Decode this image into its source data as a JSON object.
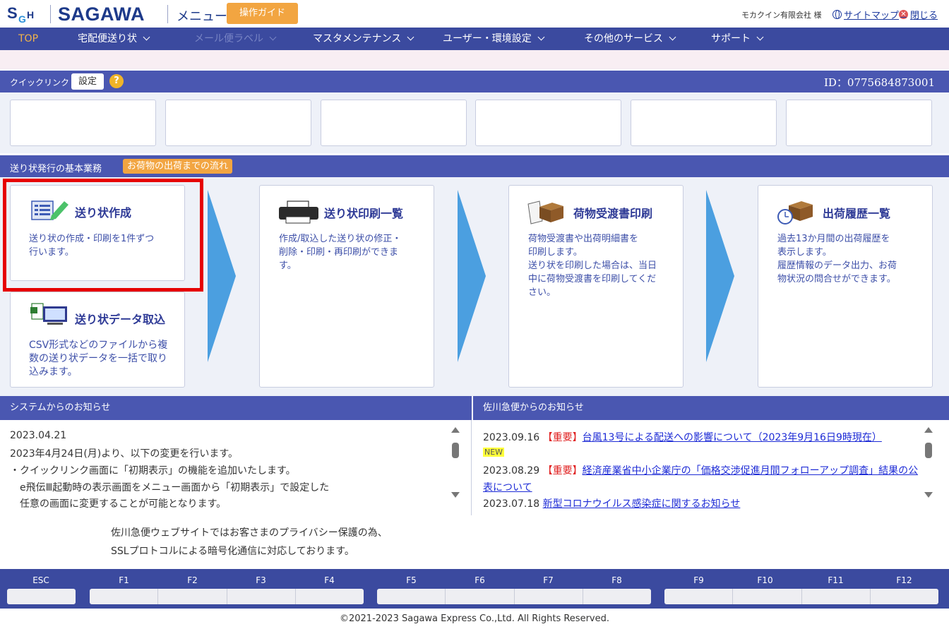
{
  "header": {
    "logo_text": "SAGAWA",
    "logo_mark": "SGH",
    "page_label": "メニュー",
    "guide_button": "操作ガイド",
    "company": "モカクイン有限会社 様",
    "sitemap": "サイトマップ",
    "close": "閉じる"
  },
  "nav": {
    "items": [
      {
        "label": "TOP",
        "state": "current"
      },
      {
        "label": "宅配便送り状",
        "state": "enabled"
      },
      {
        "label": "メール便ラベル",
        "state": "disabled"
      },
      {
        "label": "マスタメンテナンス",
        "state": "enabled"
      },
      {
        "label": "ユーザー・環境設定",
        "state": "enabled"
      },
      {
        "label": "その他のサービス",
        "state": "enabled"
      },
      {
        "label": "サポート",
        "state": "enabled"
      }
    ]
  },
  "quick_link": {
    "title": "クイックリンク",
    "setting": "設定",
    "help": "?",
    "id_text": "ID：0775684873001"
  },
  "flow": {
    "title": "送り状発行の基本業務",
    "badge": "お荷物の出荷までの流れ",
    "cards": {
      "create": {
        "title": "送り状作成",
        "desc_1": "送り状の作成・印刷を1件ずつ",
        "desc_2": "行います。"
      },
      "import": {
        "title": "送り状データ取込",
        "desc_1": "CSV形式などのファイルから複",
        "desc_2": "数の送り状データを一括で取り",
        "desc_3": "込みます。"
      },
      "print_list": {
        "title": "送り状印刷一覧",
        "desc_1": "作成/取込した送り状の修正・",
        "desc_2": "削除・印刷・再印刷ができま",
        "desc_3": "す。"
      },
      "receipt": {
        "title": "荷物受渡書印刷",
        "desc_1": "荷物受渡書や出荷明細書を",
        "desc_2": "印刷します。",
        "desc_3": "送り状を印刷した場合は、当日",
        "desc_4": "中に荷物受渡書を印刷してくだ",
        "desc_5": "さい。"
      },
      "history": {
        "title": "出荷履歴一覧",
        "desc_1": "過去13か月間の出荷履歴を",
        "desc_2": "表示します。",
        "desc_3": "履歴情報のデータ出力、お荷",
        "desc_4": "物状況の問合せができます。"
      }
    }
  },
  "system_news": {
    "title": "システムからのお知らせ",
    "lines": [
      "2023.04.21",
      "2023年4月24日(月)より、以下の変更を行います。",
      "・クイックリンク画面に「初期表示」の機能を追加いたします。",
      "　e飛伝Ⅲ起動時の表示画面をメニュー画面から「初期表示」で設定した",
      "　任意の画面に変更することが可能となります。"
    ]
  },
  "sagawa_news": {
    "title": "佐川急便からのお知らせ",
    "items": [
      {
        "date": "2023.09.16",
        "tag": "【重要】",
        "text": "台風13号による配送への影響について（2023年9月16日9時現在）",
        "new": "NEW"
      },
      {
        "date": "2023.08.29",
        "tag": "【重要】",
        "text": "経済産業省中小企業庁の「価格交渉促進月間フォローアップ調査」結果の公",
        "text_2": "表について"
      },
      {
        "date": "2023.07.18",
        "text": "新型コロナウイルス感染症に関するお知らせ"
      }
    ]
  },
  "privacy": {
    "line1": "佐川急便ウェブサイトではお客さまのプライバシー保護の為、",
    "line2": "SSLプロトコルによる暗号化通信に対応しております。"
  },
  "function_keys": [
    "ESC",
    "F1",
    "F2",
    "F3",
    "F4",
    "F5",
    "F6",
    "F7",
    "F8",
    "F9",
    "F10",
    "F11",
    "F12"
  ],
  "footer": "©2021-2023 Sagawa Express Co.,Ltd. All Rights Reserved.",
  "colors": {
    "nav_bg": "#3b4a9f",
    "bar_bg": "#4a57b1",
    "accent_orange": "#f2a541",
    "flow_arrow": "#4b9fe0",
    "highlight": "#e60000",
    "important": "#e02020"
  }
}
